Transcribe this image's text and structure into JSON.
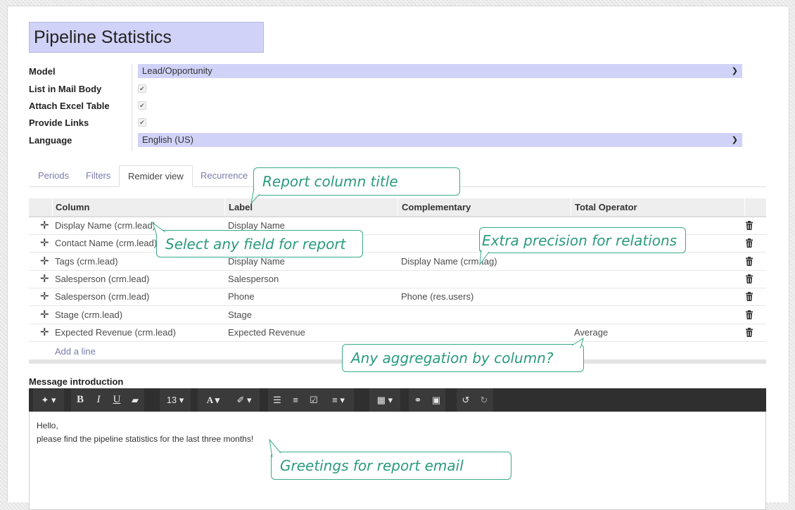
{
  "form": {
    "title": "Pipeline Statistics",
    "fields": {
      "model_label": "Model",
      "model_value": "Lead/Opportunity",
      "list_in_mail_label": "List in Mail Body",
      "attach_excel_label": "Attach Excel Table",
      "provide_links_label": "Provide Links",
      "language_label": "Language",
      "language_value": "English (US)"
    },
    "checkbox_mark": "✔"
  },
  "tabs": [
    {
      "label": "Periods"
    },
    {
      "label": "Filters"
    },
    {
      "label": "Remider view"
    },
    {
      "label": "Recurrence"
    }
  ],
  "table": {
    "columns": [
      "Column",
      "Label",
      "Complementary",
      "Total Operator"
    ],
    "rows": [
      {
        "column": "Display Name (crm.lead)",
        "label": "Display Name",
        "complementary": "",
        "operator": ""
      },
      {
        "column": "Contact Name (crm.lead)",
        "label": "",
        "complementary": "",
        "operator": ""
      },
      {
        "column": "Tags (crm.lead)",
        "label": "Display Name",
        "complementary": "Display Name (crm.tag)",
        "operator": ""
      },
      {
        "column": "Salesperson (crm.lead)",
        "label": "Salesperson",
        "complementary": "",
        "operator": ""
      },
      {
        "column": "Salesperson (crm.lead)",
        "label": "Phone",
        "complementary": "Phone (res.users)",
        "operator": ""
      },
      {
        "column": "Stage (crm.lead)",
        "label": "Stage",
        "complementary": "",
        "operator": ""
      },
      {
        "column": "Expected Revenue (crm.lead)",
        "label": "Expected Revenue",
        "complementary": "",
        "operator": "Average"
      }
    ],
    "add_line": "Add a line"
  },
  "message": {
    "label": "Message introduction",
    "font_size": "13",
    "lines": [
      "Hello,",
      "please find the pipeline statistics for the last three months!"
    ]
  },
  "callouts": {
    "report_column_title": "Report column title",
    "select_field": "Select any field for report",
    "extra_precision": "Extra precision for relations",
    "aggregation": "Any aggregation by column?",
    "greetings": "Greetings for report email"
  },
  "colors": {
    "select_bg": "#d1d2f7",
    "link": "#7c7bad",
    "callout": "#2a9a7e",
    "toolbar": "#2f2f2f"
  }
}
